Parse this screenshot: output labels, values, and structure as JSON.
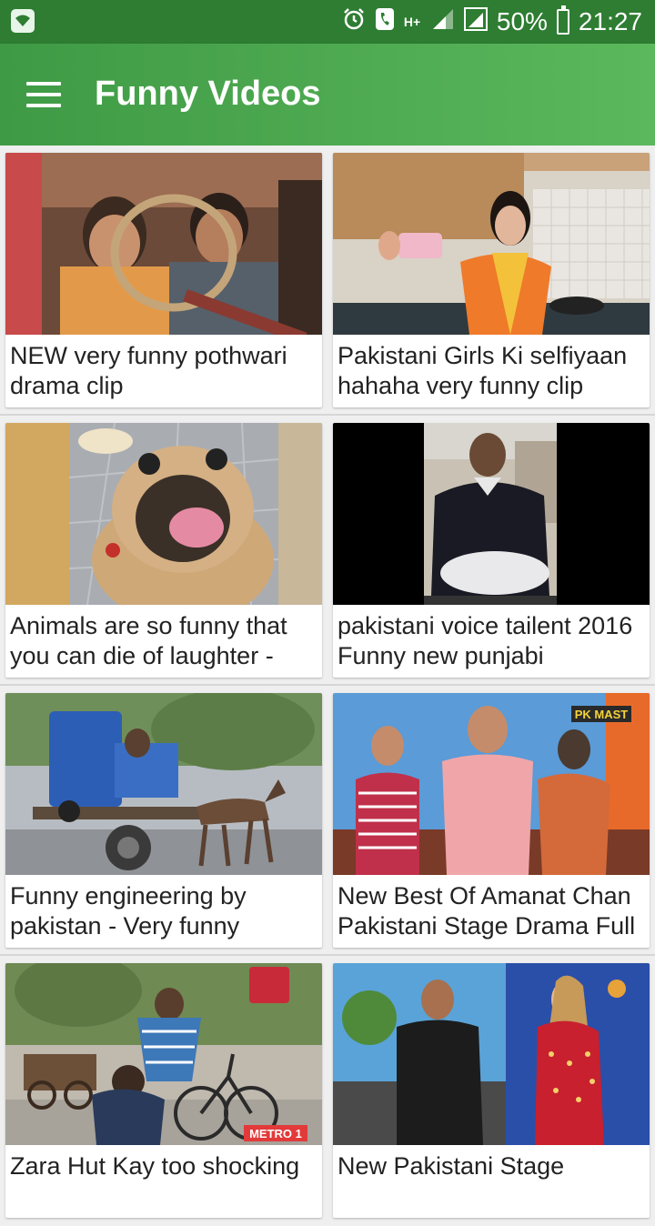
{
  "status_bar": {
    "battery": "50%",
    "time": "21:27",
    "network": "H+"
  },
  "app_bar": {
    "title": "Funny Videos"
  },
  "videos": [
    {
      "title": "NEW very funny pothwari drama clip"
    },
    {
      "title": "Pakistani Girls Ki selfiyaan hahaha very funny clip"
    },
    {
      "title": "Animals are so funny that you can die of laughter -"
    },
    {
      "title": "pakistani voice tailent 2016 Funny new punjabi"
    },
    {
      "title": "Funny engineering by pakistan - Very funny"
    },
    {
      "title": "New Best Of Amanat Chan Pakistani Stage Drama Full"
    },
    {
      "title": "Zara Hut Kay too shocking"
    },
    {
      "title": "New Pakistani Stage"
    }
  ],
  "thumb_overlays": {
    "pk_mast": "PK MAST",
    "metro": "METRO 1"
  }
}
